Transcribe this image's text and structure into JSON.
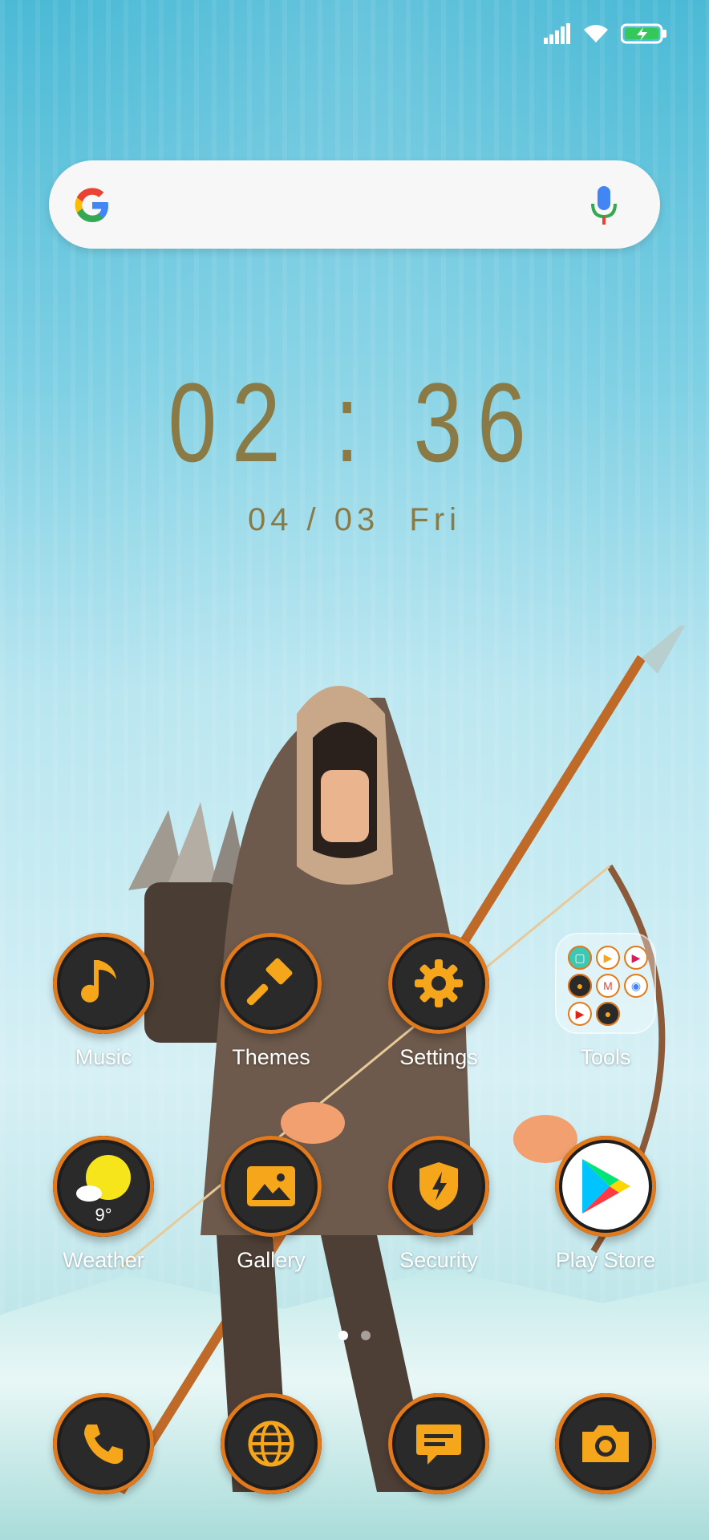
{
  "status_bar": {
    "signal_icon": "signal-icon",
    "wifi_icon": "wifi-icon",
    "battery_icon": "battery-charging-icon"
  },
  "search": {
    "logo": "google-logo",
    "mic_icon": "mic-icon"
  },
  "clock": {
    "time": "02 : 36",
    "date": "04 / 03",
    "day": "Fri"
  },
  "home_rows": [
    [
      {
        "label": "Music",
        "icon": "music-note-icon"
      },
      {
        "label": "Themes",
        "icon": "paintbrush-icon"
      },
      {
        "label": "Settings",
        "icon": "gear-icon"
      },
      {
        "label": "Tools",
        "icon": "folder-icon"
      }
    ],
    [
      {
        "label": "Weather",
        "icon": "weather-sun-icon",
        "temp": "9°"
      },
      {
        "label": "Gallery",
        "icon": "image-icon"
      },
      {
        "label": "Security",
        "icon": "shield-bolt-icon"
      },
      {
        "label": "Play Store",
        "icon": "play-store-icon"
      }
    ]
  ],
  "page_indicator": {
    "pages": 2,
    "active": 0
  },
  "dock": [
    {
      "icon": "phone-icon"
    },
    {
      "icon": "globe-icon"
    },
    {
      "icon": "messages-icon"
    },
    {
      "icon": "camera-icon"
    }
  ],
  "colors": {
    "accent": "#f6a61a",
    "ring": "#e07a1c",
    "icon_bg": "#2a2a2a",
    "clock": "#8a7a45"
  }
}
